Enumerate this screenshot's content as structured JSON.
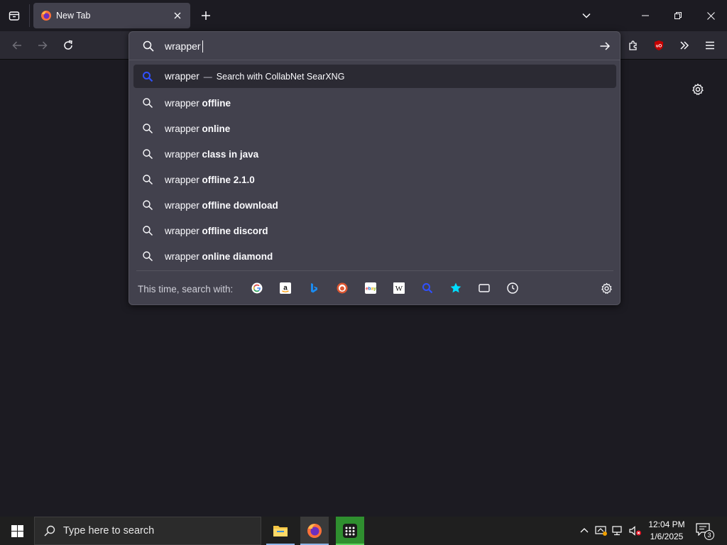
{
  "browser": {
    "tab": {
      "title": "New Tab"
    }
  },
  "urlbar": {
    "value": "wrapper",
    "heuristic": {
      "query": "wrapper",
      "separator": "—",
      "action": "Search with CollabNet SearXNG"
    },
    "suggestions": [
      {
        "prefix": "wrapper",
        "suffix": "offline"
      },
      {
        "prefix": "wrapper",
        "suffix": "online"
      },
      {
        "prefix": "wrapper",
        "suffix": "class in java"
      },
      {
        "prefix": "wrapper",
        "suffix": "offline 2.1.0"
      },
      {
        "prefix": "wrapper",
        "suffix": "offline download"
      },
      {
        "prefix": "wrapper",
        "suffix": "offline discord"
      },
      {
        "prefix": "wrapper",
        "suffix": "online diamond"
      }
    ],
    "oneoff": {
      "label": "This time, search with:",
      "engines": [
        "google-icon",
        "amazon-icon",
        "bing-icon",
        "duckduckgo-icon",
        "ebay-icon",
        "wikipedia-icon",
        "searxng-icon",
        "bookmarks-icon",
        "tabs-icon",
        "history-icon"
      ]
    }
  },
  "taskbar": {
    "search_placeholder": "Type here to search",
    "time": "12:04 PM",
    "date": "1/6/2025",
    "notification_count": "3"
  },
  "colors": {
    "accent": "#0060df",
    "searx_blue": "#3050ff",
    "firefox_orange": "#ff7139",
    "ublock_red": "#c40000"
  }
}
